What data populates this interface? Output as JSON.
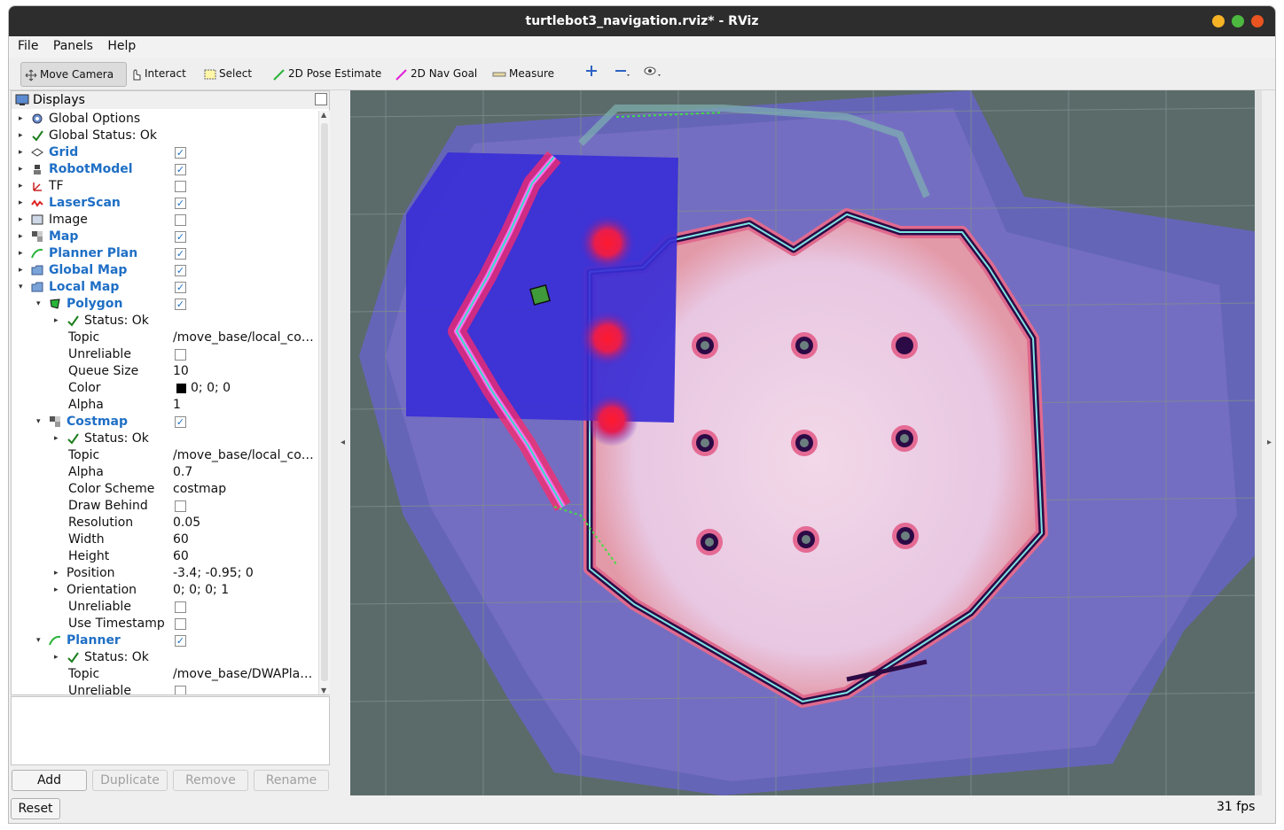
{
  "window": {
    "title": "turtlebot3_navigation.rviz* - RViz",
    "colors": {
      "close": "#e95420",
      "minimize": "#f5b225",
      "maximize": "#4cb840"
    }
  },
  "menu": {
    "file": "File",
    "panels": "Panels",
    "help": "Help"
  },
  "toolbar": {
    "move_camera": "Move Camera",
    "interact": "Interact",
    "select": "Select",
    "pose_estimate": "2D Pose Estimate",
    "nav_goal": "2D Nav Goal",
    "measure": "Measure",
    "icons": [
      "move-camera-icon",
      "interact-icon",
      "select-icon",
      "pose-estimate-icon",
      "nav-goal-icon",
      "measure-icon",
      "plus-icon",
      "minus-icon",
      "eye-icon"
    ]
  },
  "displays": {
    "title": "Displays",
    "rows": [
      {
        "label": "Global Options",
        "value": ""
      },
      {
        "label": "Global Status: Ok",
        "value": ""
      },
      {
        "label": "Grid",
        "value": ""
      },
      {
        "label": "RobotModel",
        "value": ""
      },
      {
        "label": "TF",
        "value": ""
      },
      {
        "label": "LaserScan",
        "value": ""
      },
      {
        "label": "Image",
        "value": ""
      },
      {
        "label": "Map",
        "value": ""
      },
      {
        "label": "Planner Plan",
        "value": ""
      },
      {
        "label": "Global Map",
        "value": ""
      },
      {
        "label": "Local Map",
        "value": ""
      },
      {
        "label": "Polygon",
        "value": ""
      },
      {
        "label": "Status: Ok",
        "value": ""
      },
      {
        "label": "Topic",
        "value": "/move_base/local_co…"
      },
      {
        "label": "Unreliable",
        "value": ""
      },
      {
        "label": "Queue Size",
        "value": "10"
      },
      {
        "label": "Color",
        "value": "0; 0; 0"
      },
      {
        "label": "Alpha",
        "value": "1"
      },
      {
        "label": "Costmap",
        "value": ""
      },
      {
        "label": "Status: Ok",
        "value": ""
      },
      {
        "label": "Topic",
        "value": "/move_base/local_co…"
      },
      {
        "label": "Alpha",
        "value": "0.7"
      },
      {
        "label": "Color Scheme",
        "value": "costmap"
      },
      {
        "label": "Draw Behind",
        "value": ""
      },
      {
        "label": "Resolution",
        "value": "0.05"
      },
      {
        "label": "Width",
        "value": "60"
      },
      {
        "label": "Height",
        "value": "60"
      },
      {
        "label": "Position",
        "value": "-3.4; -0.95; 0"
      },
      {
        "label": "Orientation",
        "value": "0; 0; 0; 1"
      },
      {
        "label": "Unreliable",
        "value": ""
      },
      {
        "label": "Use Timestamp",
        "value": ""
      },
      {
        "label": "Planner",
        "value": ""
      },
      {
        "label": "Status: Ok",
        "value": ""
      },
      {
        "label": "Topic",
        "value": "/move_base/DWAPla…"
      },
      {
        "label": "Unreliable",
        "value": ""
      }
    ],
    "checked": {
      "Grid": true,
      "RobotModel": true,
      "TF": false,
      "LaserScan": true,
      "Image": false,
      "Map": true,
      "Planner Plan": true,
      "Global Map": true,
      "Local Map": true,
      "Polygon": true,
      "Costmap": true,
      "Planner": true
    }
  },
  "buttons": {
    "add": "Add",
    "duplicate": "Duplicate",
    "remove": "Remove",
    "rename": "Rename",
    "reset": "Reset"
  },
  "status": {
    "fps": "31 fps"
  }
}
